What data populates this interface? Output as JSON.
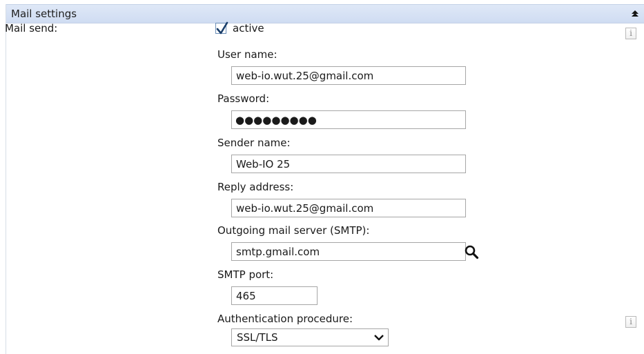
{
  "section": {
    "title": "Mail settings",
    "row_label": "Mail send:"
  },
  "active": {
    "checked": true,
    "label": "active"
  },
  "fields": {
    "user_name": {
      "label": "User name:",
      "value": "web-io.wut.25@gmail.com"
    },
    "password": {
      "label": "Password:",
      "masked": "●●●●●●●●●"
    },
    "sender_name": {
      "label": "Sender name:",
      "value": "Web-IO 25"
    },
    "reply_address": {
      "label": "Reply address:",
      "value": "web-io.wut.25@gmail.com"
    },
    "smtp_server": {
      "label": "Outgoing mail server (SMTP):",
      "value": "smtp.gmail.com"
    },
    "smtp_port": {
      "label": "SMTP port:",
      "value": "465"
    },
    "auth": {
      "label": "Authentication procedure:",
      "selected": "SSL/TLS"
    }
  },
  "icons": {
    "collapse": "collapse-up-icon",
    "info": "info-icon",
    "search": "search-icon",
    "dropdown": "chevron-down-icon"
  },
  "colors": {
    "header_bg": "#d6e2f5",
    "border": "#a6a6a6",
    "checkbox_border": "#6b8fb8"
  }
}
